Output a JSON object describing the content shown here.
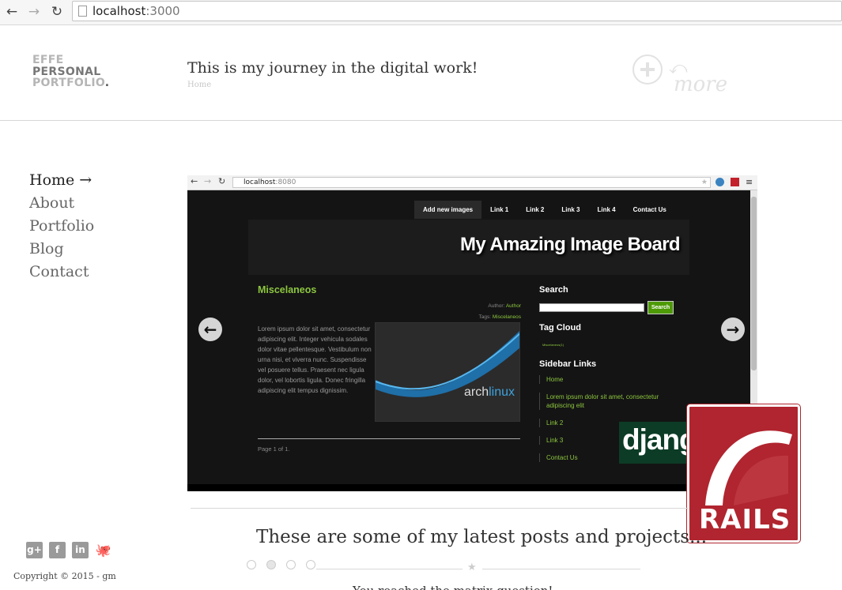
{
  "browser": {
    "url_host": "localhost",
    "url_port": ":3000"
  },
  "logo": {
    "line1": "EFFE",
    "line2": "PERSONAL",
    "line3": "PORTFOLIO",
    "dot": "."
  },
  "header": {
    "tagline": "This is my journey in the digital work!",
    "breadcrumb": "Home",
    "more_label": "more"
  },
  "nav": {
    "items": [
      {
        "label": "Home →",
        "active": true
      },
      {
        "label": "About"
      },
      {
        "label": "Portfolio"
      },
      {
        "label": "Blog"
      },
      {
        "label": "Contact"
      }
    ]
  },
  "social": {
    "icons": [
      "google-plus-icon",
      "facebook-icon",
      "linkedin-icon",
      "github-icon"
    ]
  },
  "footer": {
    "copyright": "Copyright © 2015 - gm"
  },
  "screenshot": {
    "url_host": "localhost",
    "url_port": ":8080",
    "nav_tabs": [
      "Add new images",
      "Link 1",
      "Link 2",
      "Link 3",
      "Link 4",
      "Contact Us"
    ],
    "site_title": "My Amazing Image Board",
    "post": {
      "title": "Miscelaneos",
      "author_label": "Author:",
      "author": "Author",
      "tags_label": "Tags:",
      "tags": "Miscelaneos",
      "body": "Lorem ipsum dolor sit amet, consectetur adipiscing elit. Integer vehicula sodales dolor vitae pellentesque. Vestibulum non urna nisi, et viverra nunc. Suspendisse vel posuere tellus. Praesent nec ligula dolor, vel lobortis ligula. Donec fringilla adipiscing elit tempus dignissim.",
      "image_text": "archlinux",
      "pager": "Page 1 of 1."
    },
    "sidebar": {
      "search_heading": "Search",
      "search_button": "Search",
      "tag_heading": "Tag Cloud",
      "tag_item": "Miscelaneos(1)",
      "links_heading": "Sidebar Links",
      "links": [
        "Home",
        "Lorem ipsum dolor sit amet, consectetur adipiscing elit",
        "Link 2",
        "Link 3",
        "Contact Us"
      ]
    },
    "django_text": "djang"
  },
  "rails_logo": {
    "word": "RAILS"
  },
  "latest": {
    "heading": "These are some of my latest posts and projects...",
    "subtext": "You reached the matrix question!"
  },
  "colors": {
    "accent_green": "#8cc63f",
    "rails_red": "#b0252f",
    "django_green": "#0c3c26"
  }
}
